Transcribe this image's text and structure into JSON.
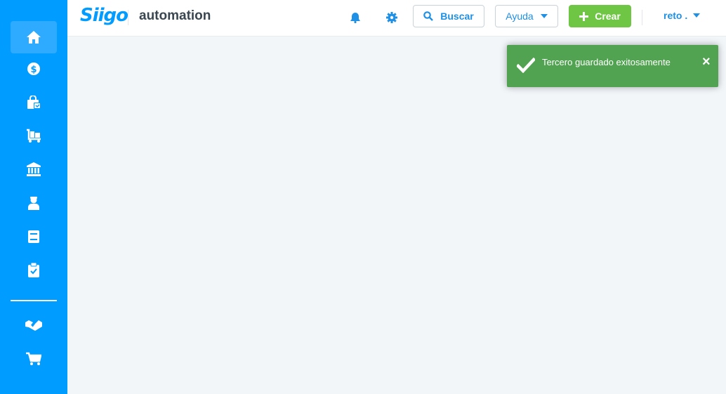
{
  "brand": {
    "logo_text": "Siigo",
    "company_name": "automation"
  },
  "colors": {
    "sidebar": "#009cff",
    "success": "#51a351",
    "create": "#6fc544",
    "accent": "#1e90e6"
  },
  "sidebar": {
    "items": [
      {
        "icon": "home-icon",
        "active": true
      },
      {
        "icon": "dollar-icon"
      },
      {
        "icon": "shopping-bag-icon"
      },
      {
        "icon": "inventory-cart-icon"
      },
      {
        "icon": "bank-icon"
      },
      {
        "icon": "employee-icon"
      },
      {
        "icon": "book-icon"
      },
      {
        "icon": "clipboard-check-icon"
      },
      {
        "icon": "handshake-icon"
      },
      {
        "icon": "cart-icon"
      }
    ]
  },
  "header": {
    "notification_icon": "bell-icon",
    "settings_icon": "gear-icon",
    "search_label": "Buscar",
    "help_label": "Ayuda",
    "create_label": "Crear",
    "user_label": "reto ."
  },
  "toast": {
    "message": "Tercero guardado exitosamente",
    "close_symbol": "×"
  }
}
